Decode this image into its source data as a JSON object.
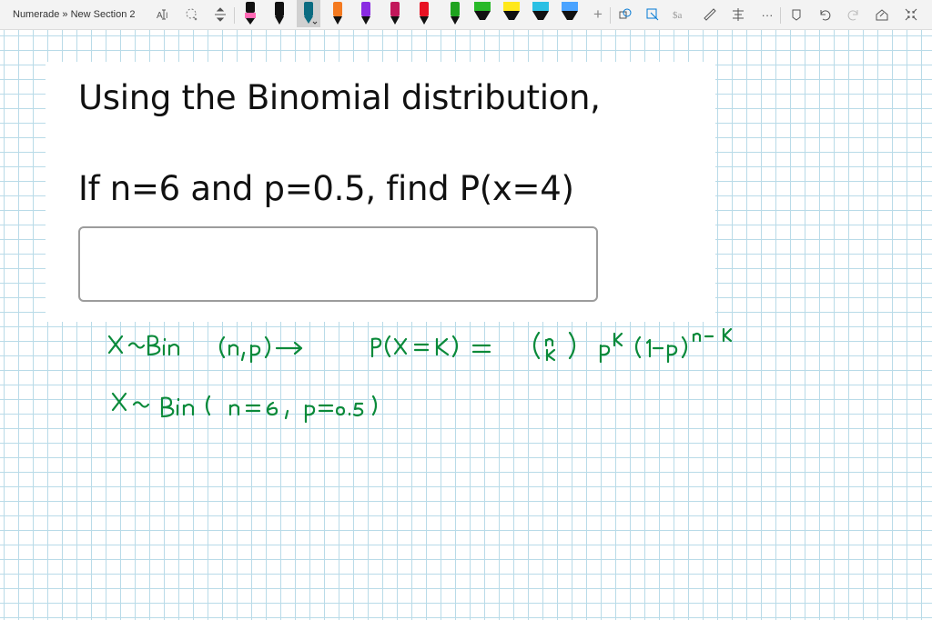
{
  "app": {
    "breadcrumb": "Numerade » New Section 2"
  },
  "toolbar": {
    "pens": [
      {
        "name": "black-pen",
        "color": "#111111"
      },
      {
        "name": "black-pen-2",
        "color": "#111111"
      },
      {
        "name": "teal-pen",
        "color": "#0b6b80",
        "active": true
      },
      {
        "name": "orange-pen",
        "color": "#f47a20"
      },
      {
        "name": "purple-pen",
        "color": "#8a2be2"
      },
      {
        "name": "magenta-pen",
        "color": "#c2185b"
      },
      {
        "name": "red-pen",
        "color": "#e81123"
      },
      {
        "name": "green-pen",
        "color": "#1fa31f"
      },
      {
        "name": "yellow-highlighter",
        "color": "#ffe81a"
      },
      {
        "name": "lime-highlighter",
        "color": "#7cd322"
      },
      {
        "name": "cyan-highlighter",
        "color": "#2bc0e4"
      },
      {
        "name": "blue-highlighter",
        "color": "#4aa3ff"
      }
    ],
    "more_label": "···"
  },
  "question": {
    "line1": "Using the Binomial distribution,",
    "line2": "If n=6 and p=0.5, find P(x=4)"
  },
  "ink": {
    "color": "#0a8a3a"
  }
}
